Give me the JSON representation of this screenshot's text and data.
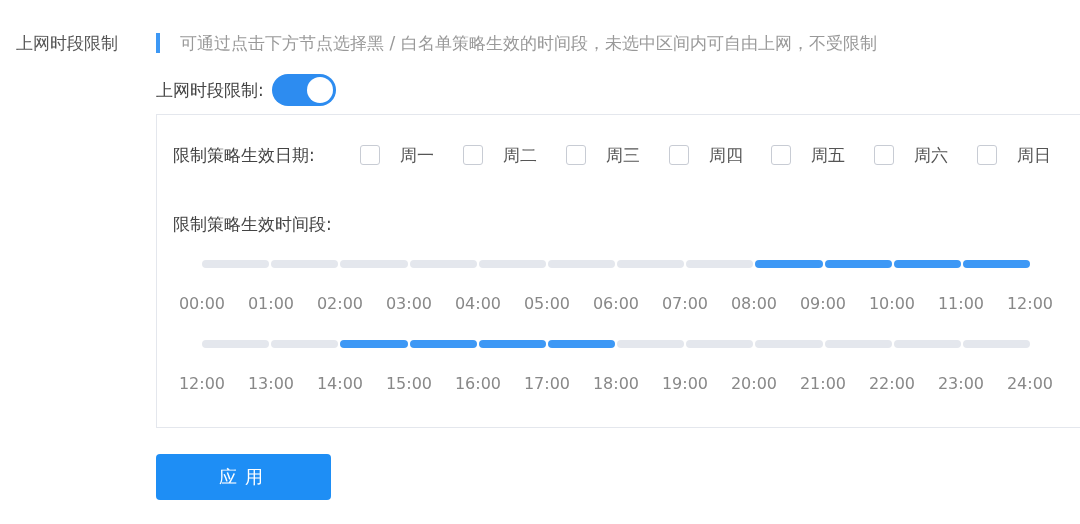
{
  "header": {
    "title": "上网时段限制",
    "description": "可通过点击下方节点选择黑 / 白名单策略生效的时间段，未选中区间内可自由上网，不受限制"
  },
  "toggle": {
    "label": "上网时段限制:",
    "on": true
  },
  "days": {
    "label": "限制策略生效日期:",
    "items": [
      {
        "label": "周一",
        "checked": false
      },
      {
        "label": "周二",
        "checked": false
      },
      {
        "label": "周三",
        "checked": false
      },
      {
        "label": "周四",
        "checked": false
      },
      {
        "label": "周五",
        "checked": false
      },
      {
        "label": "周六",
        "checked": false
      },
      {
        "label": "周日",
        "checked": false
      }
    ]
  },
  "time": {
    "label": "限制策略生效时间段:",
    "rows": [
      {
        "segments": [
          {
            "selected": false
          },
          {
            "selected": false
          },
          {
            "selected": false
          },
          {
            "selected": false
          },
          {
            "selected": false
          },
          {
            "selected": false
          },
          {
            "selected": false
          },
          {
            "selected": false
          },
          {
            "selected": true
          },
          {
            "selected": true
          },
          {
            "selected": true
          },
          {
            "selected": true
          }
        ],
        "ticks": [
          "00:00",
          "01:00",
          "02:00",
          "03:00",
          "04:00",
          "05:00",
          "06:00",
          "07:00",
          "08:00",
          "09:00",
          "10:00",
          "11:00",
          "12:00"
        ]
      },
      {
        "segments": [
          {
            "selected": false
          },
          {
            "selected": false
          },
          {
            "selected": true
          },
          {
            "selected": true
          },
          {
            "selected": true
          },
          {
            "selected": true
          },
          {
            "selected": false
          },
          {
            "selected": false
          },
          {
            "selected": false
          },
          {
            "selected": false
          },
          {
            "selected": false
          },
          {
            "selected": false
          }
        ],
        "ticks": [
          "12:00",
          "13:00",
          "14:00",
          "15:00",
          "16:00",
          "17:00",
          "18:00",
          "19:00",
          "20:00",
          "21:00",
          "22:00",
          "23:00",
          "24:00"
        ]
      }
    ]
  },
  "apply_button": "应用"
}
